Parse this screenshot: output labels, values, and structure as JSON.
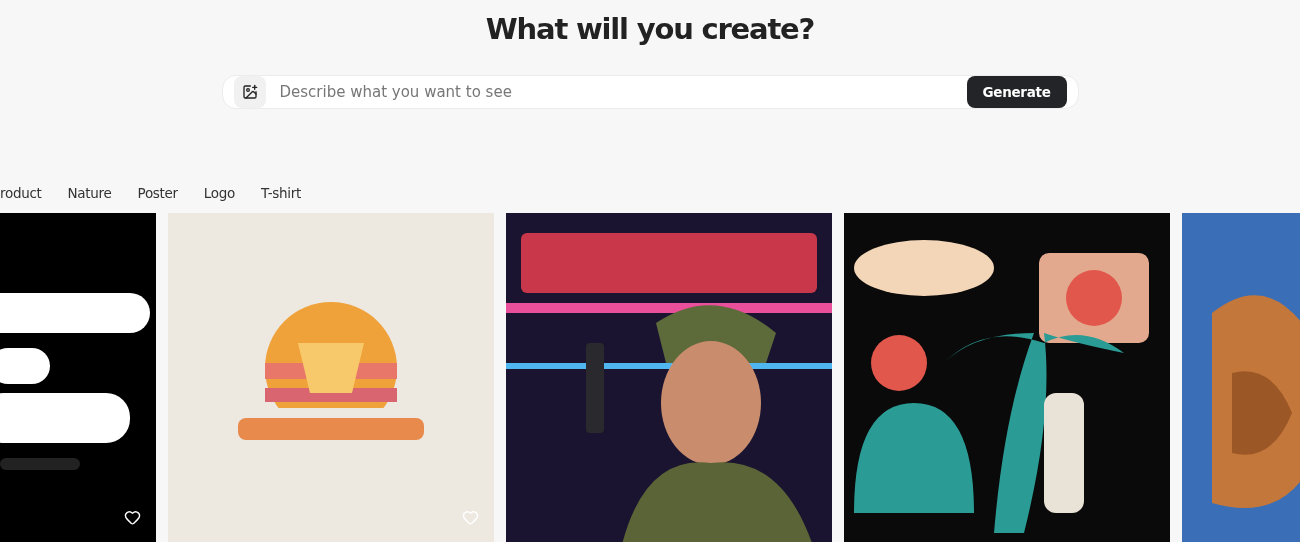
{
  "heading": "What will you create?",
  "prompt_bar": {
    "placeholder": "Describe what you want to see",
    "button": "Generate"
  },
  "categories": [
    {
      "label": "roduct",
      "selected": false
    },
    {
      "label": "Nature",
      "selected": false
    },
    {
      "label": "Poster",
      "selected": false
    },
    {
      "label": "Logo",
      "selected": false
    },
    {
      "label": "T-shirt",
      "selected": false
    }
  ]
}
